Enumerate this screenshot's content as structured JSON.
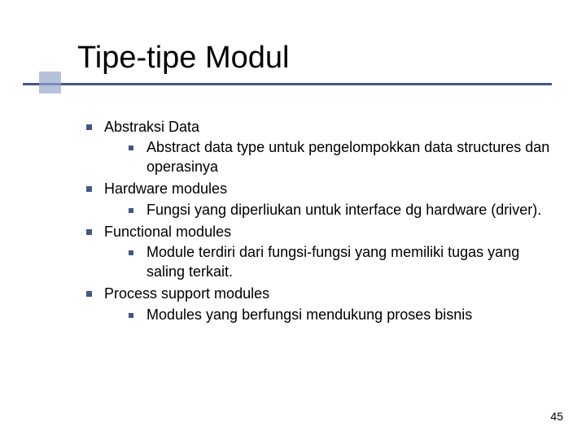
{
  "title": "Tipe-tipe Modul",
  "items": [
    {
      "label": "Abstraksi Data",
      "sub": [
        "Abstract data type untuk pengelompokkan data structures dan operasinya"
      ]
    },
    {
      "label": "Hardware modules",
      "sub": [
        "Fungsi yang diperliukan untuk interface dg hardware (driver)."
      ]
    },
    {
      "label": "Functional modules",
      "sub": [
        "Module terdiri dari fungsi-fungsi yang memiliki tugas yang saling terkait."
      ]
    },
    {
      "label": "Process support modules",
      "sub": [
        "Modules yang berfungsi mendukung proses bisnis"
      ]
    }
  ],
  "page_number": "45"
}
